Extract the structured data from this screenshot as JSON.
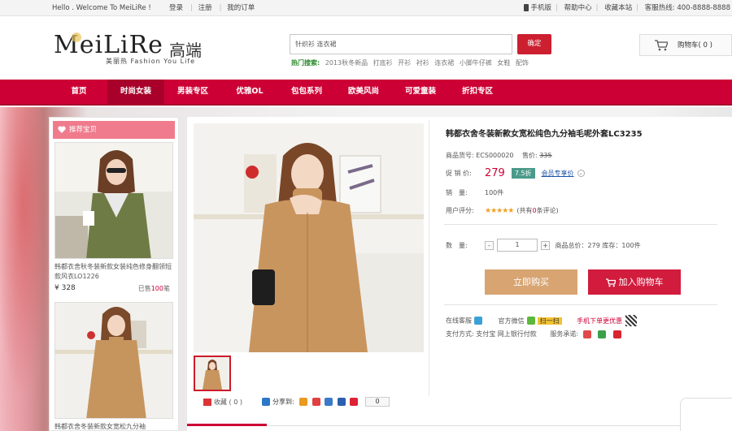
{
  "topbar": {
    "welcome": "Hello . Welcome To MeiLiRe !",
    "login": "登录",
    "register": "注册",
    "my_orders": "我的订单",
    "mobile": "手机版",
    "help": "帮助中心",
    "favorite": "收藏本站",
    "hotline": "客服热线: 400-8888-8888"
  },
  "header": {
    "logo_main": "MeiLiRe",
    "logo_cn": "高端",
    "logo_sub": "美丽热 Fashion You Life",
    "search_value": "针织衫 连衣裙",
    "search_button": "确定",
    "hot_label": "热门搜索:",
    "hot_terms": [
      "2013秋冬新品",
      "打底衫",
      "开衫",
      "衬衫",
      "连衣裙",
      "小脚牛仔裤",
      "女鞋",
      "配饰"
    ],
    "cart_label": "购物车( 0 )"
  },
  "nav": {
    "items": [
      "首页",
      "时尚女装",
      "男装专区",
      "优雅OL",
      "包包系列",
      "欧美风尚",
      "可爱童装",
      "折扣专区"
    ],
    "active_index": 1
  },
  "sidebar": {
    "title": "推荐宝贝",
    "products": [
      {
        "name": "韩都衣舍秋冬装新款女装纯色修身翻领短款风衣LO1226",
        "price": "¥ 328",
        "sold_prefix": "已售",
        "sold_count": "100",
        "sold_suffix": "笔"
      },
      {
        "name": "韩都衣舍冬装新款女宽松九分袖",
        "price": "",
        "sold_prefix": "",
        "sold_count": "",
        "sold_suffix": ""
      }
    ]
  },
  "product": {
    "title": "韩都衣舍冬装新款女宽松纯色九分袖毛呢外套LC3235",
    "sku_label": "商品货号:",
    "sku": "ECS000020",
    "list_price_label": "售价:",
    "list_price": "335",
    "promo_label": "促 销 价:",
    "promo_price": "279",
    "discount": "7.5折",
    "vip_label": "会员专享价",
    "sales_label": "销　量:",
    "sales": "100件",
    "rating_label": "用户评分:",
    "rating_value": 5,
    "rating_stars": "★★★★★",
    "review_text_prefix": "(共有",
    "review_count": "0",
    "review_text_suffix": "条评论)",
    "qty_label": "数　量:",
    "qty_minus": "-",
    "qty_value": "1",
    "qty_plus": "+",
    "total_text": "商品总价：279 库存：100件",
    "buy_now": "立即购买",
    "add_to_cart": "加入购物车",
    "online_service": "在线客服",
    "wechat": "官方微信",
    "wechat_badge": "扫一扫",
    "mobile_order": "手机下单更优惠",
    "payment_label": "支付方式:",
    "payment_methods": "支付宝 网上银行付款",
    "service_label": "服务承诺:",
    "favorite_label": "收藏",
    "favorite_count": "( 0 )",
    "share_label": "分享到:",
    "share_count": "0"
  },
  "colors": {
    "nav_red": "#cc0035",
    "price_red": "#cc0035",
    "buy_tan": "#d7a472",
    "cart_red": "#d11c3d",
    "sidebar_pink": "#f07b8d"
  }
}
